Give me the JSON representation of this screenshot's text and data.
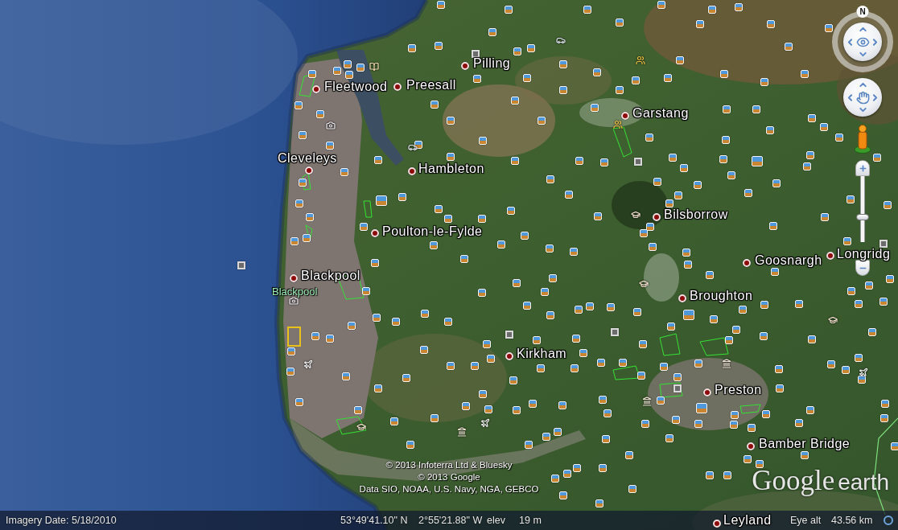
{
  "map": {
    "places": [
      {
        "name": "Pilling"
      },
      {
        "name": "Fleetwood"
      },
      {
        "name": "Preesall"
      },
      {
        "name": "Garstang"
      },
      {
        "name": "Cleveleys"
      },
      {
        "name": "Hambleton"
      },
      {
        "name": "Bilsborrow"
      },
      {
        "name": "Poulton-le-Fylde"
      },
      {
        "name": "Longridg"
      },
      {
        "name": "Goosnargh"
      },
      {
        "name": "Blackpool"
      },
      {
        "name": "Broughton"
      },
      {
        "name": "Kirkham"
      },
      {
        "name": "Preston"
      },
      {
        "name": "Bamber Bridge"
      },
      {
        "name": "Leyland"
      }
    ],
    "district_label": "Blackpool"
  },
  "navigation": {
    "north_label": "N",
    "zoom_slider": {
      "level": 0.38
    }
  },
  "attribution": [
    "© 2013 Infoterra Ltd & Bluesky",
    "© 2013 Google",
    "Data SIO, NOAA, U.S. Navy, NGA, GEBCO"
  ],
  "logo": {
    "brand": "Google",
    "product": "earth"
  },
  "status_bar": {
    "imagery_date": "Imagery Date: 5/18/2010",
    "latitude": "53°49'41.10\" N",
    "longitude": "2°55'21.88\" W",
    "elevation_label": "elev",
    "elevation": "19 m",
    "eye_alt_label": "Eye alt",
    "eye_alt": "43.56 km"
  }
}
